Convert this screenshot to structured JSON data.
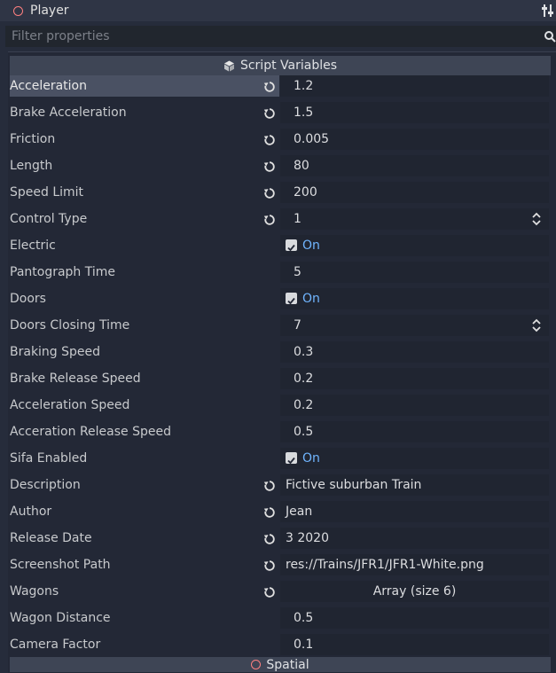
{
  "node": {
    "title": "Player"
  },
  "filter": {
    "placeholder": "Filter properties"
  },
  "section": {
    "title": "Script Variables"
  },
  "properties": [
    {
      "label": "Acceleration",
      "value": "1.2",
      "type": "number",
      "revert": true,
      "selected": true
    },
    {
      "label": "Brake Acceleration",
      "value": "1.5",
      "type": "number",
      "revert": true
    },
    {
      "label": "Friction",
      "value": "0.005",
      "type": "number",
      "revert": true
    },
    {
      "label": "Length",
      "value": "80",
      "type": "number",
      "revert": true
    },
    {
      "label": "Speed Limit",
      "value": "200",
      "type": "number",
      "revert": true
    },
    {
      "label": "Control Type",
      "value": "1",
      "type": "enum",
      "revert": true
    },
    {
      "label": "Electric",
      "value": "On",
      "type": "bool",
      "revert": false
    },
    {
      "label": "Pantograph Time",
      "value": "5",
      "type": "number",
      "revert": false
    },
    {
      "label": "Doors",
      "value": "On",
      "type": "bool",
      "revert": false
    },
    {
      "label": "Doors Closing Time",
      "value": "7",
      "type": "enum",
      "revert": false
    },
    {
      "label": "Braking Speed",
      "value": "0.3",
      "type": "number",
      "revert": false
    },
    {
      "label": "Brake Release Speed",
      "value": "0.2",
      "type": "number",
      "revert": false
    },
    {
      "label": "Acceleration Speed",
      "value": "0.2",
      "type": "number",
      "revert": false
    },
    {
      "label": "Acceration Release Speed",
      "value": "0.5",
      "type": "number",
      "revert": false
    },
    {
      "label": "Sifa Enabled",
      "value": "On",
      "type": "bool",
      "revert": false
    },
    {
      "label": "Description",
      "value": "Fictive suburban Train",
      "type": "text",
      "revert": true
    },
    {
      "label": "Author",
      "value": "Jean",
      "type": "text",
      "revert": true
    },
    {
      "label": "Release Date",
      "value": "3 2020",
      "type": "text",
      "revert": true
    },
    {
      "label": "Screenshot Path",
      "value": "res://Trains/JFR1/JFR1-White.png",
      "type": "text",
      "revert": true
    },
    {
      "label": "Wagons",
      "value": "Array (size 6)",
      "type": "array",
      "revert": true
    },
    {
      "label": "Wagon Distance",
      "value": "0.5",
      "type": "number",
      "revert": false
    },
    {
      "label": "Camera Factor",
      "value": "0.1",
      "type": "number",
      "revert": false
    }
  ],
  "footer_section": {
    "title": "Spatial"
  },
  "colors": {
    "accent_on": "#70b5ff",
    "node_icon": "#fc7f7f",
    "background": "#262c3b"
  }
}
